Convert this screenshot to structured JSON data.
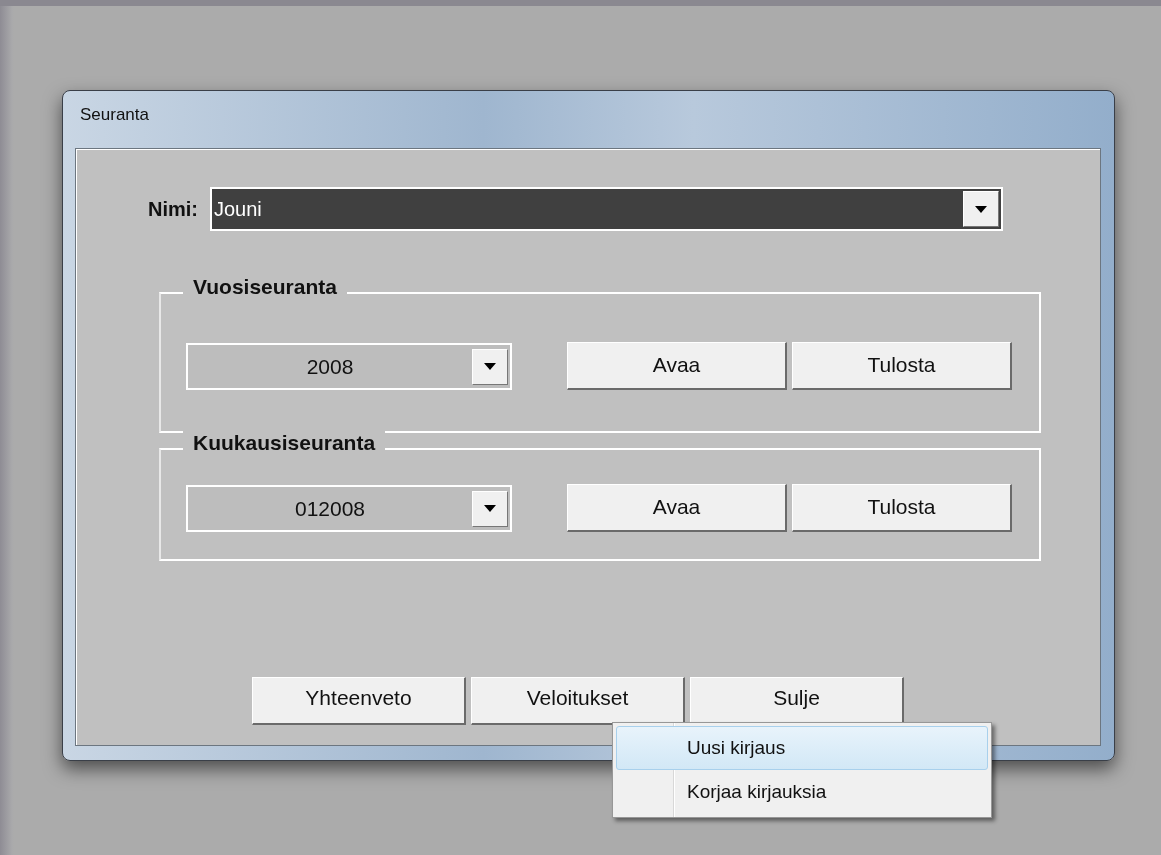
{
  "window": {
    "title": "Seuranta"
  },
  "name_field": {
    "label": "Nimi:",
    "value": "Jouni"
  },
  "groups": [
    {
      "title": "Vuosiseuranta",
      "value": "2008",
      "buttons": [
        "Avaa",
        "Tulosta"
      ]
    },
    {
      "title": "Kuukausiseuranta",
      "value": "012008",
      "buttons": [
        "Avaa",
        "Tulosta"
      ]
    }
  ],
  "buttons": [
    "Yhteenveto",
    "Veloitukset",
    "Sulje"
  ],
  "context_menu": {
    "items": [
      {
        "label": "Uusi kirjaus",
        "selected": true
      },
      {
        "label": "Korjaa kirjauksia",
        "selected": false
      }
    ]
  }
}
